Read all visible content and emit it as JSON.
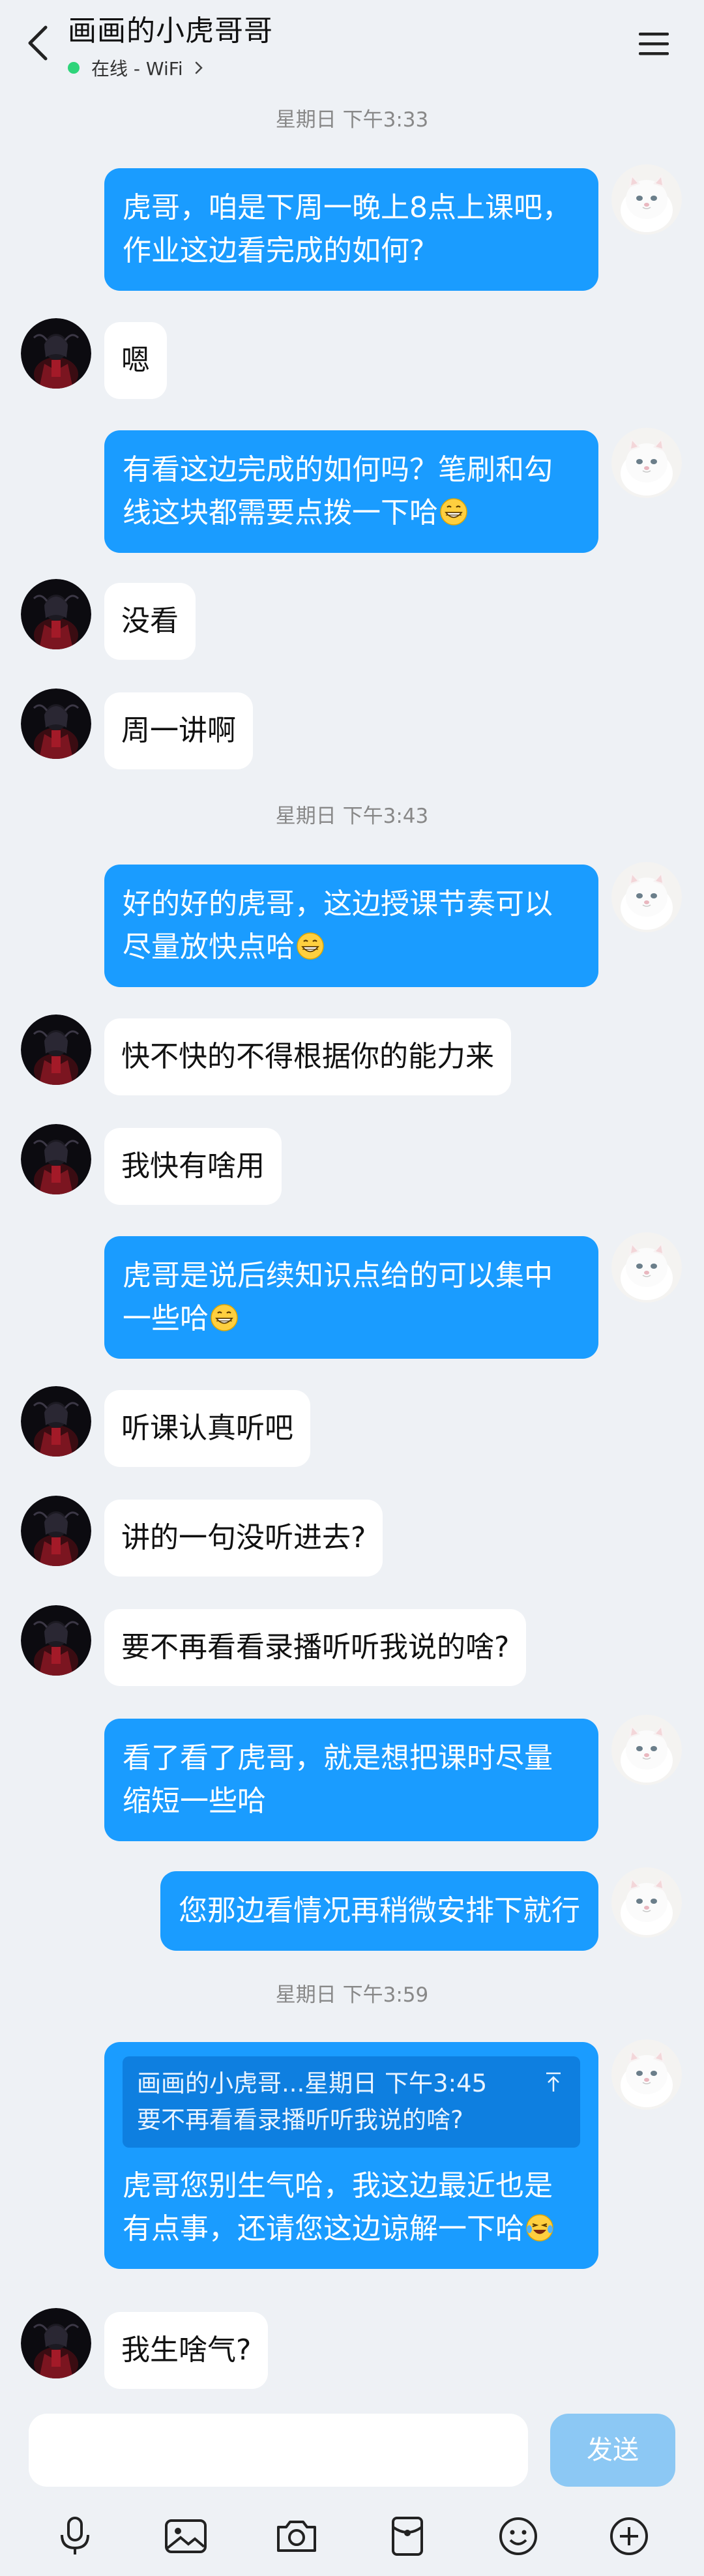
{
  "header": {
    "title": "画画的小虎哥哥",
    "status": "在线 - WiFi"
  },
  "timestamps": {
    "t1": "星期日 下午3:33",
    "t2": "星期日 下午3:43",
    "t3": "星期日 下午3:59"
  },
  "messages": {
    "m1": "虎哥，咱是下周一晚上8点上课吧，作业这边看完成的如何?",
    "m2": "嗯",
    "m3": "有看这边完成的如何吗？笔刷和勾线这块都需要点拨一下哈",
    "m4": "没看",
    "m5": "周一讲啊",
    "m6": "好的好的虎哥，这边授课节奏可以尽量放快点哈",
    "m7": "快不快的不得根据你的能力来",
    "m8": "我快有啥用",
    "m9": "虎哥是说后续知识点给的可以集中一些哈",
    "m10": "听课认真听吧",
    "m11": "讲的一句没听进去?",
    "m12": "要不再看看录播听听我说的啥?",
    "m13": "看了看了虎哥，就是想把课时尽量缩短一些哈",
    "m14": "您那边看情况再稍微安排下就行",
    "m15_quote_header": "画画的小虎哥...星期日 下午3:45",
    "m15_quote_text": "要不再看看录播听听我说的啥?",
    "m15": "虎哥您别生气哈，我这边最近也是有点事，还请您这边谅解一下哈",
    "m16": "我生啥气?"
  },
  "input": {
    "value": "",
    "send_label": "发送"
  },
  "colors": {
    "outgoing_bubble": "#1a9cff",
    "incoming_bubble": "#ffffff",
    "background": "#eef1f5",
    "online": "#2ed47a",
    "send_button": "#8cc8f4"
  },
  "icons": {
    "back": "chevron-left-icon",
    "menu": "menu-icon",
    "toolbar": [
      "microphone-icon",
      "image-icon",
      "camera-icon",
      "red-packet-icon",
      "emoji-icon",
      "plus-icon"
    ]
  }
}
